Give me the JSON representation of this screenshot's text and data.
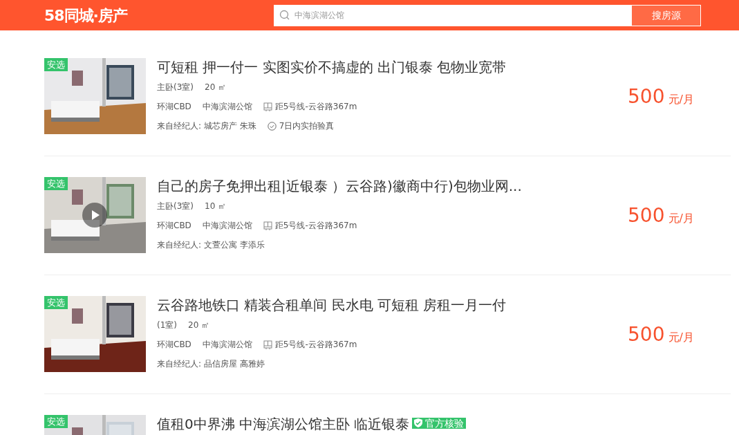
{
  "header": {
    "logo": "58同城·房产",
    "search": {
      "placeholder": "中海滨湖公馆",
      "button": "搜房源"
    }
  },
  "listings": [
    {
      "badge": "安选",
      "video": false,
      "title": "可短租 押一付一 实图实价不搞虚的 出门银泰 包物业宽带",
      "room": "主卧(3室)",
      "area": "20 ㎡",
      "district": "环湖CBD",
      "complex": "中海滨湖公馆",
      "subway": "距5号线-云谷路367m",
      "agent": "来自经纪人: 城芯房产 朱珠",
      "check": "7日内实拍验真",
      "price": "500",
      "unit": "元/月"
    },
    {
      "badge": "安选",
      "video": true,
      "title": "自己的房子免押出租|近银泰 ）云谷路)徽商中行)包物业网...",
      "room": "主卧(3室)",
      "area": "10 ㎡",
      "district": "环湖CBD",
      "complex": "中海滨湖公馆",
      "subway": "距5号线-云谷路367m",
      "agent": "来自经纪人: 文萱公寓 李添乐",
      "price": "500",
      "unit": "元/月"
    },
    {
      "badge": "安选",
      "video": false,
      "title": "云谷路地铁口 精装合租单间 民水电 可短租 房租一月一付",
      "room": "(1室)",
      "area": "20 ㎡",
      "district": "环湖CBD",
      "complex": "中海滨湖公馆",
      "subway": "距5号线-云谷路367m",
      "agent": "来自经纪人: 品信房屋 高雅婷",
      "price": "500",
      "unit": "元/月"
    },
    {
      "badge": "安选",
      "video": false,
      "title": "值租0中界沸 中海滨湖公馆主卧 临近银泰",
      "verified": "官方核验"
    }
  ]
}
